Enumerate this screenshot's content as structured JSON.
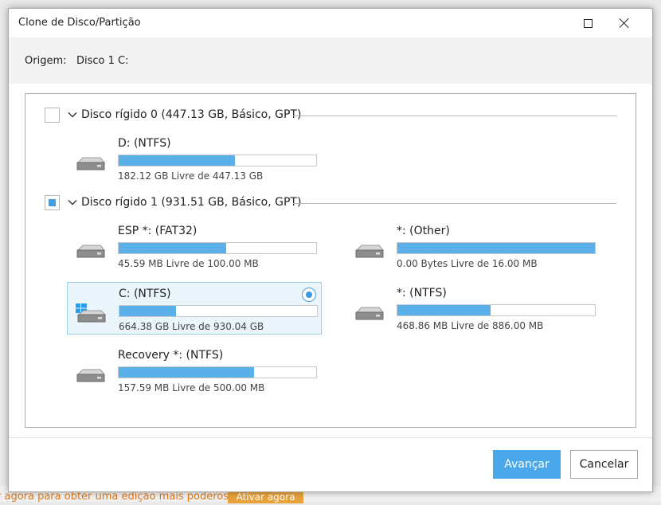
{
  "window": {
    "title": "Clone de Disco/Partição"
  },
  "origin": {
    "label": "Origem:",
    "value": "Disco 1 C:"
  },
  "disks": [
    {
      "title": "Disco rígido 0 (447.13 GB, Básico, GPT)",
      "checkbox_state": "unchecked",
      "partitions": [
        {
          "name": "D: (NTFS)",
          "free_text": "182.12 GB Livre de 447.13 GB",
          "used_fraction": 0.59,
          "icon": "hard-drive-icon",
          "selected": false
        }
      ]
    },
    {
      "title": "Disco rígido 1 (931.51 GB, Básico, GPT)",
      "checkbox_state": "partial",
      "partitions": [
        {
          "name": "ESP *: (FAT32)",
          "free_text": "45.59 MB Livre de 100.00 MB",
          "used_fraction": 0.544,
          "icon": "hard-drive-icon",
          "selected": false
        },
        {
          "name": "*: (Other)",
          "free_text": "0.00 Bytes Livre de 16.00 MB",
          "used_fraction": 1.0,
          "icon": "hard-drive-icon",
          "selected": false
        },
        {
          "name": "C: (NTFS)",
          "free_text": "664.38 GB Livre de 930.04 GB",
          "used_fraction": 0.286,
          "icon": "windows-drive-icon",
          "selected": true
        },
        {
          "name": "*: (NTFS)",
          "free_text": "468.86 MB Livre de 886.00 MB",
          "used_fraction": 0.471,
          "icon": "hard-drive-icon",
          "selected": false
        },
        {
          "name": "Recovery *: (NTFS)",
          "free_text": "157.59 MB Livre de 500.00 MB",
          "used_fraction": 0.685,
          "icon": "hard-drive-icon",
          "selected": false
        }
      ]
    }
  ],
  "buttons": {
    "next": "Avançar",
    "cancel": "Cancelar"
  },
  "background_app": {
    "promo_text": "r agora para obter uma edição mais poderosa.",
    "activate_button": "Ativar agora"
  },
  "colors": {
    "accent": "#4aa7ea",
    "bar_fill": "#5bb0ea",
    "selection_bg": "#ebf5fc"
  }
}
